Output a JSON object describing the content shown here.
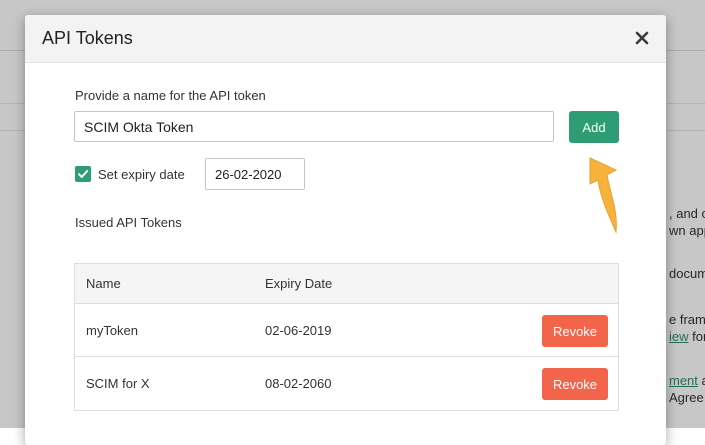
{
  "background": {
    "fragments": [
      {
        "text": ", and c",
        "link": false
      },
      {
        "text": "wn app",
        "link": false
      },
      {
        "text": "docum",
        "link": false
      },
      {
        "text": "e frame",
        "link": false
      },
      {
        "text": "iew",
        "link": true
      },
      {
        "text": " for",
        "link": false
      },
      {
        "text": "ment",
        "link": true
      },
      {
        "text": " an",
        "link": false
      },
      {
        "text": "Agree",
        "link": false
      }
    ]
  },
  "modal": {
    "title": "API Tokens",
    "close_icon": "close-icon",
    "name_label": "Provide a name for the API token",
    "name_value": "SCIM Okta Token",
    "add_label": "Add",
    "expiry_checked": true,
    "expiry_label": "Set expiry date",
    "expiry_value": "26-02-2020",
    "issued_title": "Issued API Tokens",
    "table": {
      "headers": {
        "name": "Name",
        "expiry": "Expiry Date"
      },
      "rows": [
        {
          "name": "myToken",
          "expiry": "02-06-2019",
          "action": "Revoke"
        },
        {
          "name": "SCIM for X",
          "expiry": "08-02-2060",
          "action": "Revoke"
        }
      ]
    }
  },
  "colors": {
    "accent": "#2e9c74",
    "danger": "#f2654a",
    "annotation_arrow": "#f5b23c"
  }
}
